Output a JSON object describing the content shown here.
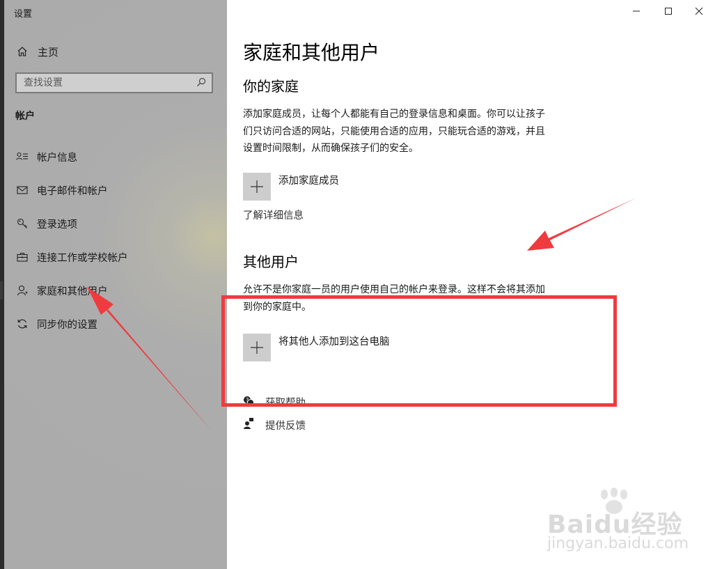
{
  "window": {
    "title": "设置",
    "controls": {
      "minimize_icon": "minimize-icon",
      "maximize_icon": "maximize-icon",
      "close_icon": "close-icon"
    }
  },
  "sidebar": {
    "home_label": "主页",
    "home_icon": "home-icon",
    "search_placeholder": "查找设置",
    "search_icon": "search-icon",
    "section_title": "帐户",
    "items": [
      {
        "label": "帐户信息",
        "icon": "account-info-icon"
      },
      {
        "label": "电子邮件和帐户",
        "icon": "mail-icon"
      },
      {
        "label": "登录选项",
        "icon": "key-icon"
      },
      {
        "label": "连接工作或学校帐户",
        "icon": "briefcase-icon"
      },
      {
        "label": "家庭和其他用户",
        "icon": "person-icon",
        "selected": true
      },
      {
        "label": "同步你的设置",
        "icon": "sync-icon"
      }
    ]
  },
  "main": {
    "title": "家庭和其他用户",
    "family": {
      "heading": "你的家庭",
      "description": "添加家庭成员，让每个人都能有自己的登录信息和桌面。你可以让孩子们只访问合适的网站，只能使用合适的应用，只能玩合适的游戏，并且设置时间限制，从而确保孩子们的安全。",
      "add_label": "添加家庭成员",
      "learn_more": "了解详细信息"
    },
    "other_users": {
      "heading": "其他用户",
      "description": "允许不是你家庭一员的用户使用自己的帐户来登录。这样不会将其添加到你的家庭中。",
      "add_label": "将其他人添加到这台电脑"
    },
    "help": {
      "get_help": "获取帮助",
      "feedback": "提供反馈"
    }
  },
  "annotation": {
    "color": "#ef3b3f"
  },
  "watermark": {
    "brand": "Baidu经验",
    "url": "jingyan.baidu.com"
  }
}
